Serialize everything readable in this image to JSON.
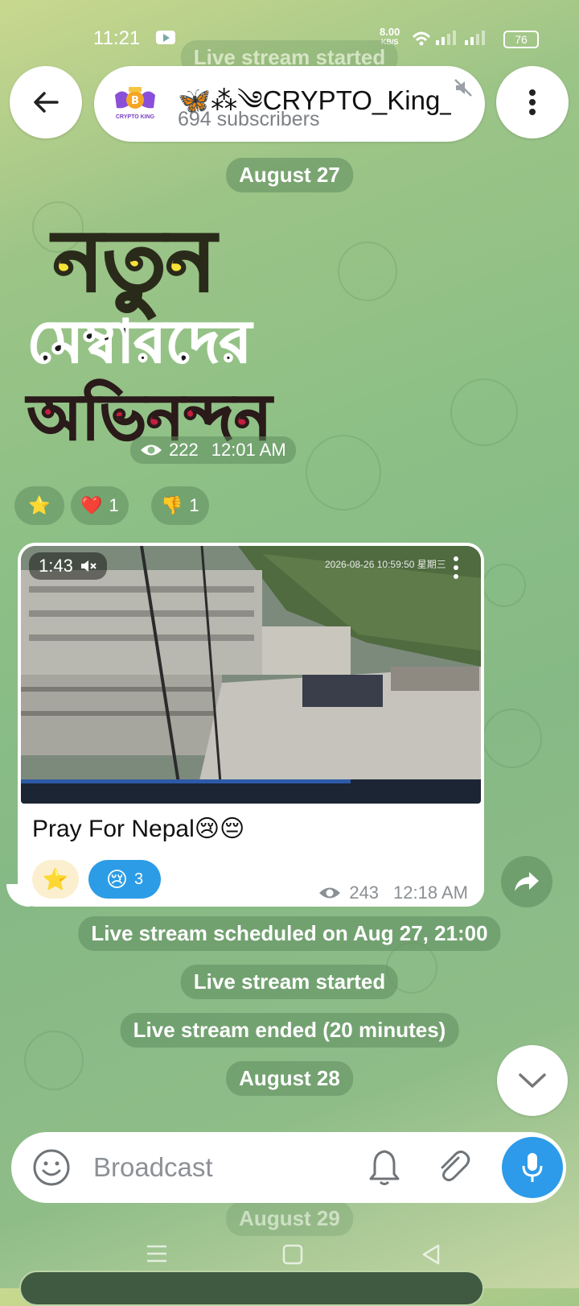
{
  "status_bar": {
    "time": "11:21",
    "speed_value": "8.00",
    "speed_unit": "KB/S",
    "battery": "76"
  },
  "header": {
    "channel_name": "🦋⁂༄CRYPTO_King_C",
    "subscribers": "694 subscribers",
    "avatar_text": "CRYPTO KING"
  },
  "ghost_top_pill": "Live stream started",
  "date_aug27": "August 27",
  "image_post": {
    "line1": "নতুন",
    "line2": "মেম্বারদের",
    "line3": "অভিনন্দন",
    "views": "222",
    "time": "12:01 AM"
  },
  "reactions_post1": [
    {
      "emoji": "⭐",
      "count": ""
    },
    {
      "emoji": "❤️",
      "count": "1"
    },
    {
      "emoji": "👎",
      "count": "1"
    }
  ],
  "video_post": {
    "duration": "1:43",
    "timestamp_overlay": "2026-08-26 10:59:50 星期三",
    "caption": "Pray For Nepal😢😔",
    "react_star": "⭐",
    "react_cry_emoji": "😢",
    "react_cry_count": "3",
    "views": "243",
    "time": "12:18 AM"
  },
  "service_messages": {
    "scheduled": "Live stream scheduled on Aug 27, 21:00",
    "started": "Live stream started",
    "ended": "Live stream ended (20 minutes)",
    "date_aug28": "August 28",
    "date_aug29": "August 29"
  },
  "composer": {
    "placeholder": "Broadcast"
  },
  "colors": {
    "accent": "#2d9be9",
    "bubble": "#ffffff",
    "service_pill": "#5f8c5f"
  }
}
